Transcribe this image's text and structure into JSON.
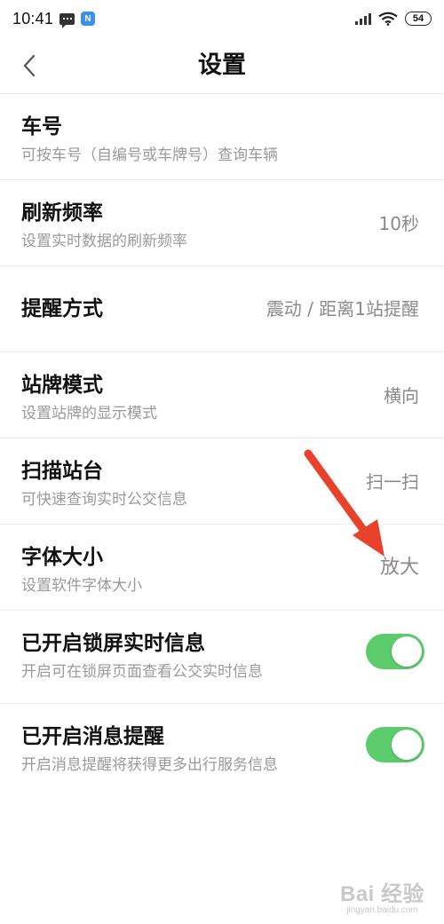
{
  "status_bar": {
    "time": "10:41",
    "battery": "54",
    "icons": [
      "message-icon",
      "app-notification-icon",
      "signal-icon",
      "wifi-icon",
      "battery-icon"
    ]
  },
  "header": {
    "title": "设置",
    "back_icon": "chevron-left-icon"
  },
  "settings": [
    {
      "title": "车号",
      "subtitle": "可按车号（自编号或车牌号）查询车辆",
      "value": ""
    },
    {
      "title": "刷新频率",
      "subtitle": "设置实时数据的刷新频率",
      "value": "10秒"
    },
    {
      "title": "提醒方式",
      "subtitle": "",
      "value": "震动 / 距离1站提醒"
    },
    {
      "title": "站牌模式",
      "subtitle": "设置站牌的显示模式",
      "value": "横向"
    },
    {
      "title": "扫描站台",
      "subtitle": "可快速查询实时公交信息",
      "value": "扫一扫"
    },
    {
      "title": "字体大小",
      "subtitle": "设置软件字体大小",
      "value": "放大"
    },
    {
      "title": "已开启锁屏实时信息",
      "subtitle": "开启可在锁屏页面查看公交实时信息",
      "toggle_on": true
    },
    {
      "title": "已开启消息提醒",
      "subtitle": "开启消息提醒将获得更多出行服务信息",
      "toggle_on": true
    }
  ],
  "annotation": {
    "color": "#e8412c",
    "icon": "red-arrow-annotation"
  },
  "watermark": {
    "logo": "Bai 经验",
    "url": "jingyan.baidu.com"
  },
  "colors": {
    "toggle_on": "#5ccb6c",
    "subtitle": "#9a9a9a",
    "value": "#8a8a8a"
  }
}
